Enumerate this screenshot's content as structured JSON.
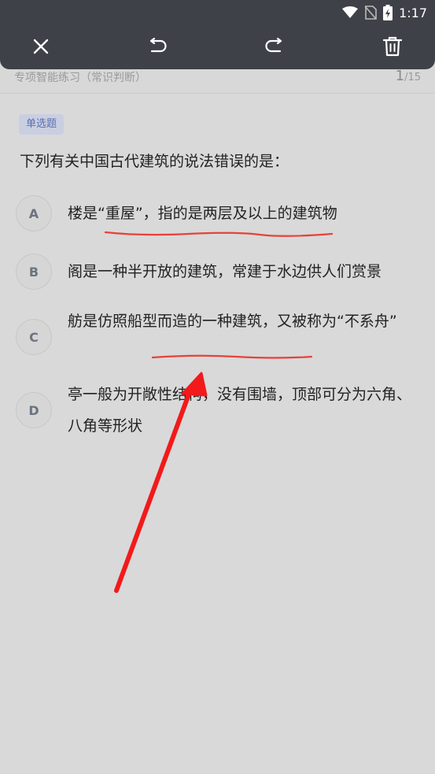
{
  "status_bar": {
    "time": "1:17"
  },
  "toolbar": {
    "close_icon": "close-icon",
    "undo_icon": "undo-icon",
    "redo_icon": "redo-icon",
    "delete_icon": "trash-icon"
  },
  "header": {
    "title": "专项智能练习（常识判断）",
    "current": "1",
    "total": "/15"
  },
  "question": {
    "type": "单选题",
    "text": "下列有关中国古代建筑的说法错误的是：",
    "options": [
      {
        "letter": "A",
        "text": "楼是“重屋”，指的是两层及以上的建筑物"
      },
      {
        "letter": "B",
        "text": "阁是一种半开放的建筑，常建于水边供人们赏景"
      },
      {
        "letter": "C",
        "text": "舫是仿照船型而造的一种建筑，又被称为“不系舟”"
      },
      {
        "letter": "D",
        "text": "亭一般为开敞性结构，没有围墙，顶部可分为六角、八角等形状"
      }
    ]
  },
  "colors": {
    "topbar": "#3f4148",
    "background": "#d9d9d9",
    "tag_bg": "#c9cfe0",
    "tag_text": "#5b6fb2",
    "annotation": "#e8413a"
  }
}
